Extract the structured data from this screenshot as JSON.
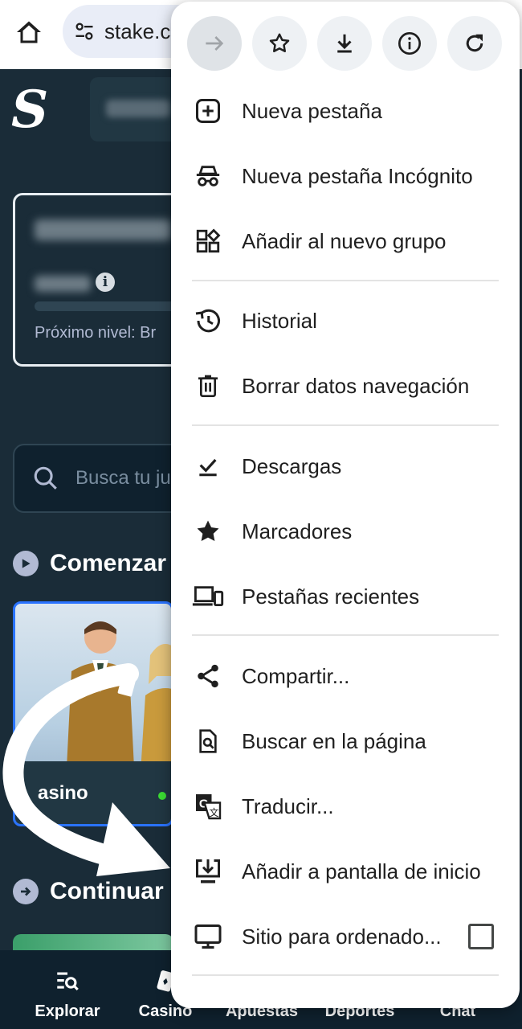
{
  "browser": {
    "url_text": "stake.c"
  },
  "stake": {
    "logo": "S",
    "vip": {
      "next_level": "Próximo nivel: Br"
    },
    "search_placeholder": "Busca tu ju",
    "section1": "Comenzar",
    "section2": "Continuar",
    "game_card_label": "asino"
  },
  "bottom_nav": [
    {
      "label": "Explorar",
      "icon": "search-list-icon"
    },
    {
      "label": "Casino",
      "icon": "cards-icon"
    },
    {
      "label": "Apuestas",
      "icon": "ticket-icon"
    },
    {
      "label": "Deportes",
      "icon": "ball-icon"
    },
    {
      "label": "Chat",
      "icon": "chat-icon"
    }
  ],
  "menu": {
    "toolbar": [
      {
        "name": "forward",
        "icon": "arrow-forward-icon",
        "disabled": true
      },
      {
        "name": "bookmark",
        "icon": "star-outline-icon"
      },
      {
        "name": "download",
        "icon": "download-icon"
      },
      {
        "name": "page-info",
        "icon": "info-icon"
      },
      {
        "name": "reload",
        "icon": "refresh-icon"
      }
    ],
    "items": [
      {
        "label": "Nueva pestaña",
        "icon": "plus-box-icon"
      },
      {
        "label": "Nueva pestaña Incógnito",
        "icon": "incognito-icon"
      },
      {
        "label": "Añadir al nuevo grupo",
        "icon": "tab-group-icon"
      },
      {
        "label": "Historial",
        "icon": "history-icon"
      },
      {
        "label": "Borrar datos navegación",
        "icon": "trash-icon"
      },
      {
        "label": "Descargas",
        "icon": "downloads-check-icon"
      },
      {
        "label": "Marcadores",
        "icon": "star-filled-icon"
      },
      {
        "label": "Pestañas recientes",
        "icon": "devices-icon"
      },
      {
        "label": "Compartir...",
        "icon": "share-icon"
      },
      {
        "label": "Buscar en la página",
        "icon": "find-in-page-icon"
      },
      {
        "label": "Traducir...",
        "icon": "translate-icon"
      },
      {
        "label": "Añadir a pantalla de inicio",
        "icon": "add-to-home-icon"
      },
      {
        "label": "Sitio para ordenado...",
        "icon": "desktop-icon",
        "checkbox": false
      }
    ]
  }
}
